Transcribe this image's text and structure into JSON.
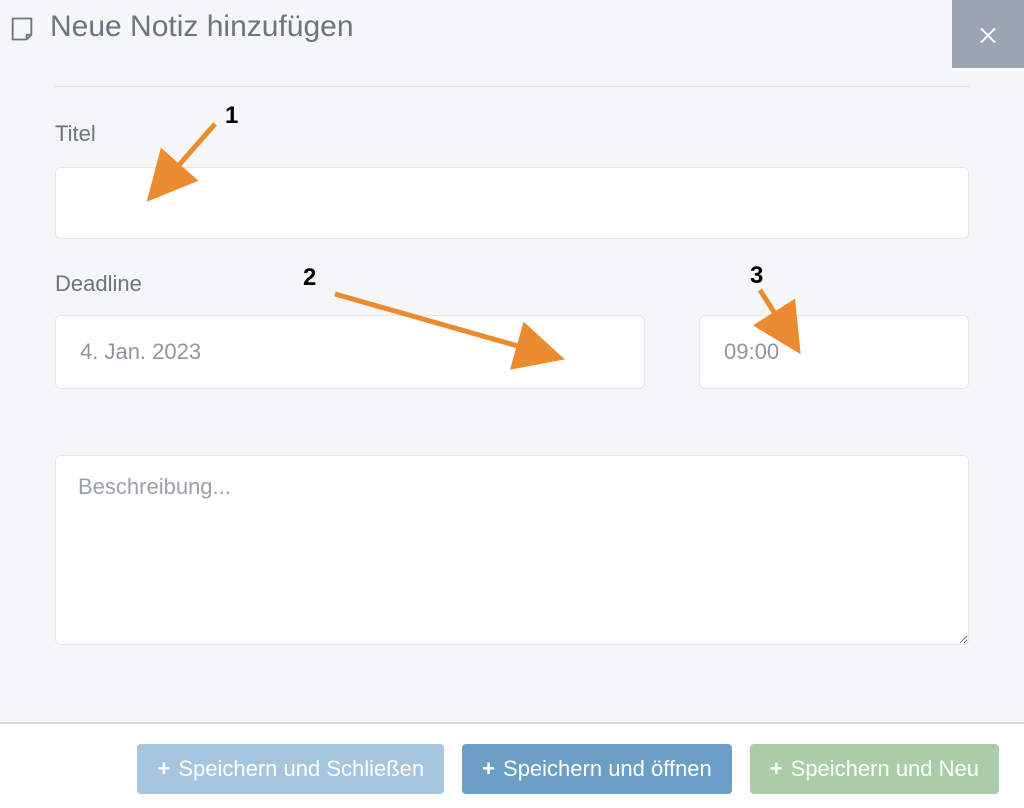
{
  "header": {
    "title": "Neue Notiz hinzufügen"
  },
  "labels": {
    "title_field": "Titel",
    "deadline": "Deadline",
    "description_placeholder": "Beschreibung..."
  },
  "values": {
    "title": "",
    "date": "4. Jan. 2023",
    "time": "09:00",
    "description": ""
  },
  "buttons": {
    "save_close": "Speichern und Schließen",
    "save_open": "Speichern und öffnen",
    "save_new": "Speichern und Neu"
  },
  "annotations": {
    "a1": "1",
    "a2": "2",
    "a3": "3"
  }
}
